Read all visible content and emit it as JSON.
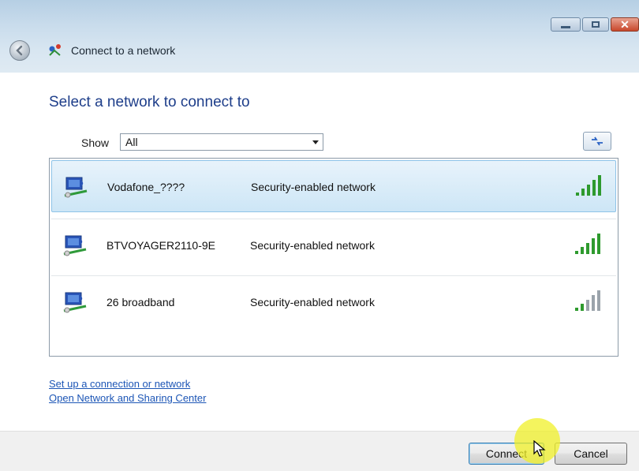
{
  "window": {
    "title": "Connect to a network",
    "controls": [
      "minimize",
      "maximize",
      "close"
    ]
  },
  "heading": "Select a network to connect to",
  "filter": {
    "label": "Show",
    "selected": "All"
  },
  "networks": [
    {
      "name": "Vodafone_????",
      "security": "Security-enabled network",
      "signal_bars": 5,
      "selected": true
    },
    {
      "name": "BTVOYAGER2110-9E",
      "security": "Security-enabled network",
      "signal_bars": 5,
      "selected": false
    },
    {
      "name": "26 broadband",
      "security": "Security-enabled network",
      "signal_bars": 2,
      "selected": false
    }
  ],
  "links": {
    "setup": "Set up a connection or network",
    "sharing_center": "Open Network and Sharing Center"
  },
  "buttons": {
    "connect": "Connect",
    "cancel": "Cancel"
  },
  "colors": {
    "heading": "#1e3e8a",
    "link": "#1d56b6",
    "signal_on": "#2e9a2e",
    "signal_off": "#9aa3ab",
    "selection": "#cde6f6"
  }
}
